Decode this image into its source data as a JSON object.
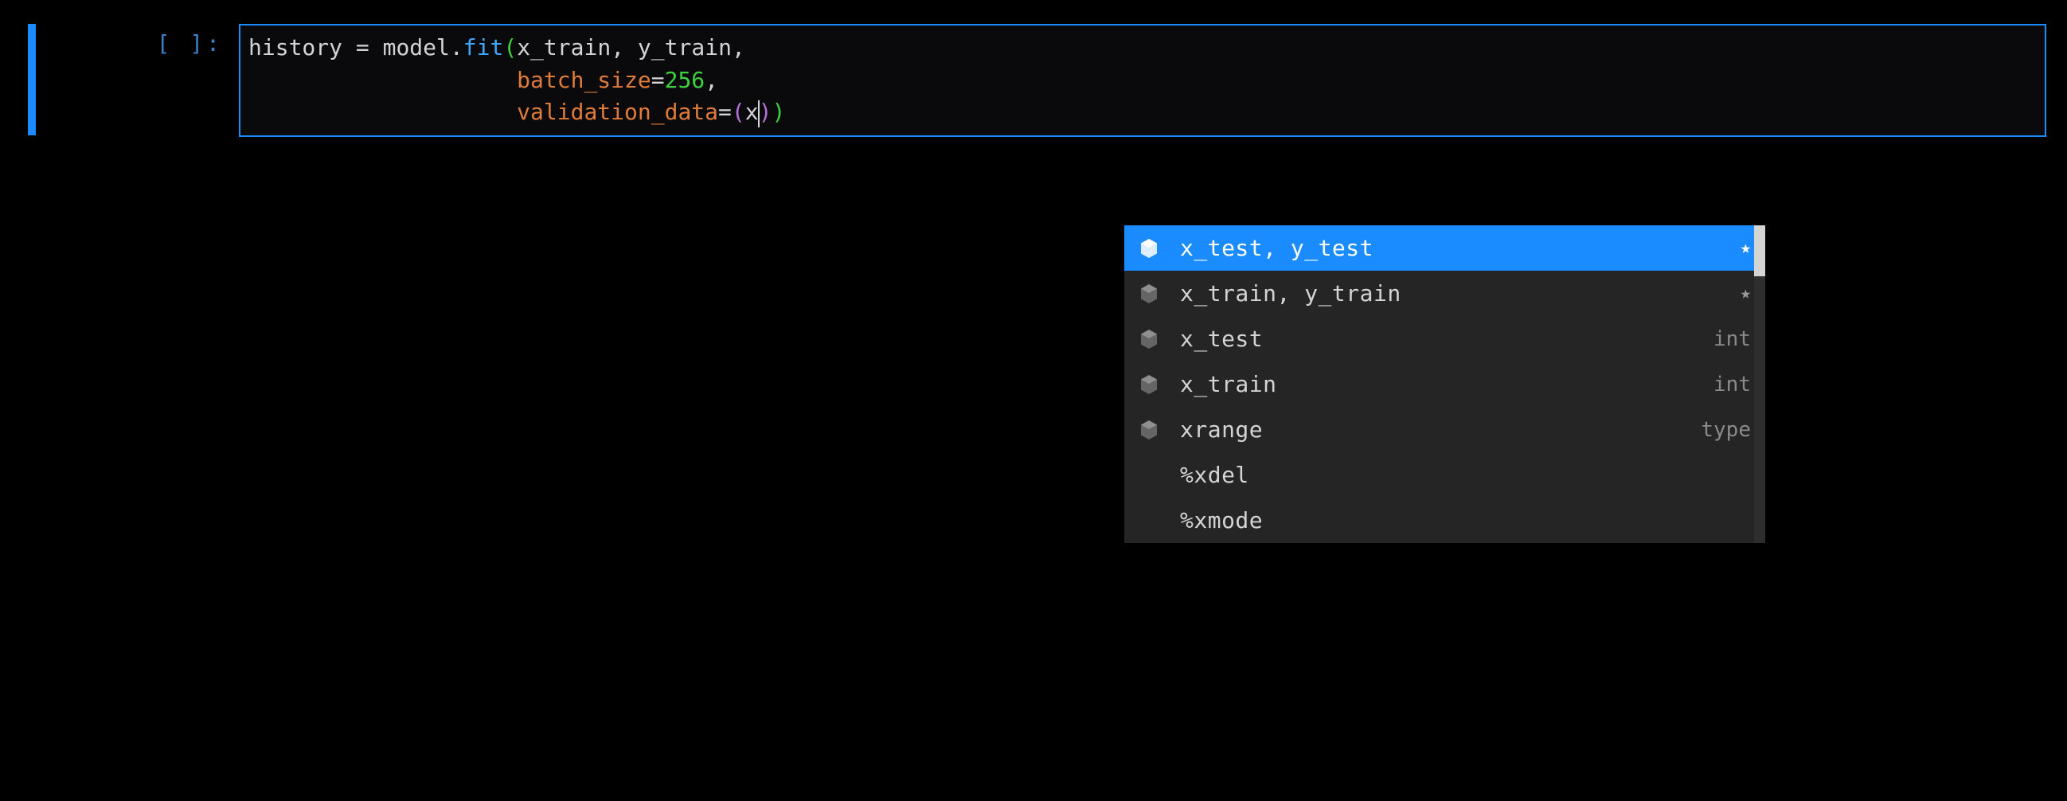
{
  "cell": {
    "prompt": "[ ]:",
    "indent2": "                    ",
    "tokens": {
      "history": "history",
      "assign": " = ",
      "model": "model.",
      "fit": "fit",
      "lp": "(",
      "rp": ")",
      "x_train": "x_train",
      "comma_sp": ", ",
      "y_train": "y_train",
      "comma": ",",
      "batch_size": "batch_size",
      "eq": "=",
      "num256": "256",
      "validation_data": "validation_data",
      "lp_inner": "(",
      "x": "x",
      "rp_inner": ")"
    }
  },
  "autocomplete": {
    "items": [
      {
        "label": "x_test, y_test",
        "meta": "",
        "icon": true,
        "star": true,
        "selected": true
      },
      {
        "label": "x_train, y_train",
        "meta": "",
        "icon": true,
        "star": true,
        "selected": false
      },
      {
        "label": "x_test",
        "meta": "int",
        "icon": true,
        "star": false,
        "selected": false
      },
      {
        "label": "x_train",
        "meta": "int",
        "icon": true,
        "star": false,
        "selected": false
      },
      {
        "label": "xrange",
        "meta": "type",
        "icon": true,
        "star": false,
        "selected": false
      },
      {
        "label": "%xdel",
        "meta": "",
        "icon": false,
        "star": false,
        "selected": false
      },
      {
        "label": "%xmode",
        "meta": "",
        "icon": false,
        "star": false,
        "selected": false
      }
    ],
    "star_glyph": "★"
  }
}
